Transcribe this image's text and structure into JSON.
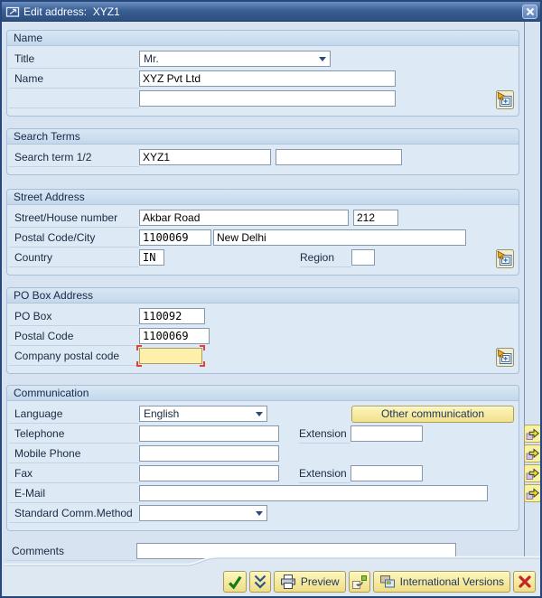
{
  "window": {
    "title": "Edit address:  XYZ1"
  },
  "name_section": {
    "header": "Name",
    "title_label": "Title",
    "title_value": "Mr.",
    "name_label": "Name",
    "name_value": "XYZ Pvt Ltd",
    "name2_value": ""
  },
  "search_section": {
    "header": "Search Terms",
    "label": "Search term 1/2",
    "term1": "XYZ1",
    "term2": ""
  },
  "street_section": {
    "header": "Street Address",
    "street_label": "Street/House number",
    "street_value": "Akbar Road",
    "house_value": "212",
    "postal_city_label": "Postal Code/City",
    "postal_value": "1100069",
    "city_value": "New Delhi",
    "country_label": "Country",
    "country_value": "IN",
    "region_label": "Region",
    "region_value": ""
  },
  "pobox_section": {
    "header": "PO Box Address",
    "pobox_label": "PO Box",
    "pobox_value": "110092",
    "postal_label": "Postal Code",
    "postal_value": "1100069",
    "company_label": "Company postal code",
    "company_value": ""
  },
  "comm_section": {
    "header": "Communication",
    "language_label": "Language",
    "language_value": "English",
    "other_button": "Other communication",
    "telephone_label": "Telephone",
    "telephone_value": "",
    "extension_label": "Extension",
    "telephone_ext_value": "",
    "mobile_label": "Mobile Phone",
    "mobile_value": "",
    "fax_label": "Fax",
    "fax_value": "",
    "fax_ext_value": "",
    "email_label": "E-Mail",
    "email_value": "",
    "std_label": "Standard Comm.Method",
    "std_value": ""
  },
  "comments_section": {
    "label": "Comments",
    "value": ""
  },
  "footer": {
    "preview_label": "Preview",
    "intl_label": "International Versions"
  },
  "icons": {
    "titlebar": "edit-window-icon",
    "close": "x-icon",
    "group_detail": "detail-expand-icon (window with plus and cursor arrow)",
    "combo": "chevron-down-icon",
    "comm_row": "yellow-right-arrow-icon",
    "continue": "green-check-icon",
    "copy": "double-chevron-down-icon",
    "preview": "printer-icon",
    "undo": "undo-box-arrow-icon",
    "international": "overlapping-windows-icon",
    "cancel": "red-x-icon"
  },
  "colors": {
    "titlebar_blue": "#3a5f94",
    "dialog_bg": "#d7e3f1",
    "group_header": "#c4d8eb",
    "focus_yellow": "#fcf0ab",
    "focus_corner_red": "#df4338",
    "button_yellow": "#f5e79a",
    "ok_green": "#167a16",
    "cancel_red": "#c42525"
  }
}
